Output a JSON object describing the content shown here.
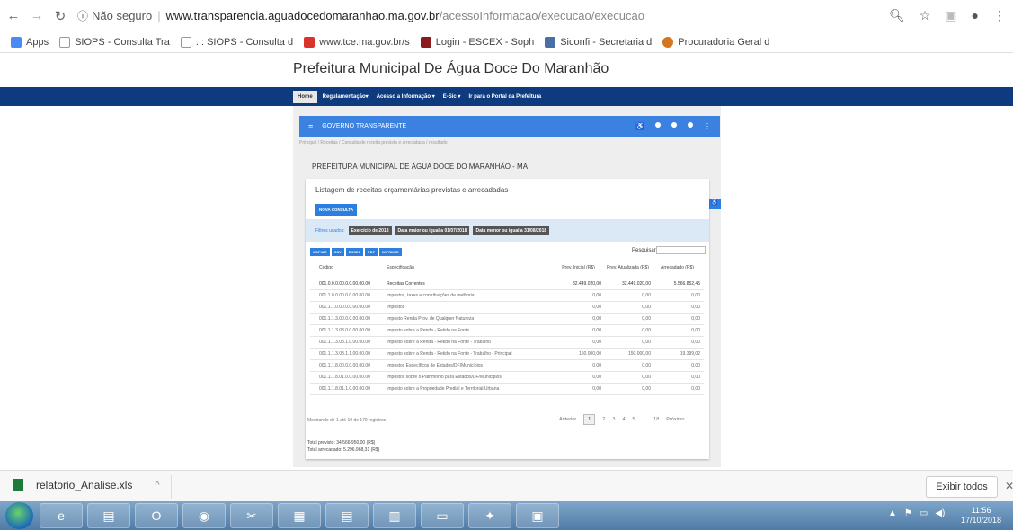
{
  "browser": {
    "security_label": "Não seguro",
    "url_host": "www.transparencia.aguadocedomaranhao.ma.gov.br",
    "url_path": "/acessoInformacao/execucao/execucao",
    "bookmarks": [
      {
        "label": "Apps",
        "color": "#4a8af4"
      },
      {
        "label": "SIOPS - Consulta Tra",
        "color": "#cccccc"
      },
      {
        "label": ". : SIOPS - Consulta d",
        "color": "#cccccc"
      },
      {
        "label": "www.tce.ma.gov.br/s",
        "color": "#d9342b"
      },
      {
        "label": "Login - ESCEX - Soph",
        "color": "#8b1a1a"
      },
      {
        "label": "Siconfi - Secretaria d",
        "color": "#4a6fa5"
      },
      {
        "label": "Procuradoria Geral d",
        "color": "#d4761f"
      }
    ]
  },
  "site": {
    "title": "Prefeitura Municipal De Água Doce Do Maranhão",
    "nav": [
      "Home",
      "Regulamentação▾",
      "Acesso a Informação ▾",
      "E-Sic ▾",
      "Ir para o Portal da Prefeitura"
    ],
    "brand": "GOVERNO TRANSPARENTE",
    "breadcrumb": "Principal / Receitas / Consulta de receita prevista e arrecadada / resultado",
    "org_title": "PREFEITURA MUNICIPAL DE ÁGUA DOCE DO MARANHÃO - MA"
  },
  "card": {
    "heading": "Listagem de receitas orçamentárias previstas e arrecadadas",
    "new_query": "NOVA CONSULTA",
    "filters_label": "Filtros usados:",
    "filters": [
      "Exercício de 2018",
      "Data maior ou igual a 01/07/2018",
      "Data menor ou igual a 31/08/2018"
    ],
    "export_buttons": [
      "COPIAR",
      "CSV",
      "EXCEL",
      "PDF",
      "IMPRIMIR"
    ],
    "search_label": "Pesquisar",
    "columns": [
      "Código",
      "Especificação",
      "Prev. Inicial (R$)",
      "Prev. Atualizada (R$)",
      "Arrecadado (R$)"
    ],
    "rows": [
      [
        "001.0.0.0.00.0.0.00.00.00",
        "Receitas Correntes",
        "32.449.020,00",
        "32.449.020,00",
        "5.566.852,45"
      ],
      [
        "001.1.0.0.00.0.0.00.00.00",
        "Impostos, taxas e contribuições de melhoria",
        "0,00",
        "0,00",
        "0,00"
      ],
      [
        "001.1.1.0.00.0.0.00.00.00",
        "Impostos",
        "0,00",
        "0,00",
        "0,00"
      ],
      [
        "001.1.1.3.00.0.0.00.00.00",
        "Imposto Renda Prov. de Qualquer Natureza",
        "0,00",
        "0,00",
        "0,00"
      ],
      [
        "001.1.1.3.03.0.0.00.00.00",
        "Imposto sobre a Renda - Retido na Fonte",
        "0,00",
        "0,00",
        "0,00"
      ],
      [
        "001.1.1.3.03.1.0.00.00.00",
        "Imposto sobre a Renda - Retido na Fonte - Trabalho",
        "0,00",
        "0,00",
        "0,00"
      ],
      [
        "001.1.1.3.03.1.1.00.00.00",
        "Imposto sobre a Renda - Retido na Fonte - Trabalho - Principal",
        "150.000,00",
        "150.000,00",
        "19.399,02"
      ],
      [
        "001.1.1.8.00.0.0.00.00.00",
        "Impostos Específicos de Estados/DF/Municípios",
        "0,00",
        "0,00",
        "0,00"
      ],
      [
        "001.1.1.8.01.0.0.00.00.00",
        "Impostos sobre o Patrimônio para Estados/DF/Municípios",
        "0,00",
        "0,00",
        "0,00"
      ],
      [
        "001.1.1.8.01.1.0.00.00.00",
        "Imposto sobre a Propriedade Predial e Territorial Urbana",
        "0,00",
        "0,00",
        "0,00"
      ]
    ],
    "showing": "Mostrando de 1 até 10 de 179 registros",
    "pager": {
      "prev": "Anterior",
      "pages": [
        "1",
        "2",
        "3",
        "4",
        "5",
        "...",
        "18"
      ],
      "next": "Próximo"
    },
    "total_previsto": "Total previsto: 34.566.950,00 (R$)",
    "total_arrecadado": "Total arrecadado: 5.296.968,31 (R$)"
  },
  "downloads": {
    "file": "relatorio_Analise.xls",
    "show_all": "Exibir todos"
  },
  "taskbar": {
    "time": "11:56",
    "date": "17/10/2018"
  }
}
